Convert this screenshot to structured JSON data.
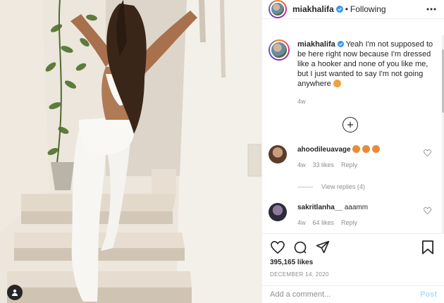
{
  "post": {
    "username": "miakhalifa",
    "separator": "•",
    "follow_status": "Following",
    "caption_username": "miakhalifa",
    "caption_text": "Yeah I'm not supposed to be here right now because I'm dressed like a hooker and none of you like me, but I just wanted to say I'm not going anywhere",
    "caption_time": "4w",
    "likes": "395,165 likes",
    "date": "December 14, 2020"
  },
  "comments": [
    {
      "username": "ahoodileuavage",
      "text": "",
      "time": "4w",
      "likes": "33 likes",
      "reply": "Reply"
    },
    {
      "username": "sakritlanha__",
      "text": "aaamm",
      "time": "4w",
      "likes": "64 likes",
      "reply": "Reply"
    }
  ],
  "view_replies": "View replies (4)",
  "add_comment": {
    "placeholder": "Add a comment..."
  },
  "post_button": "Post",
  "colors": {
    "accent_blue": "#0095f6",
    "post_button_disabled": "#b3dbff",
    "verified": "#3897f0"
  },
  "icons": [
    "more-icon",
    "heart-icon",
    "comment-icon",
    "share-icon",
    "save-icon",
    "plus-icon",
    "verified-icon",
    "user-tag-icon"
  ]
}
